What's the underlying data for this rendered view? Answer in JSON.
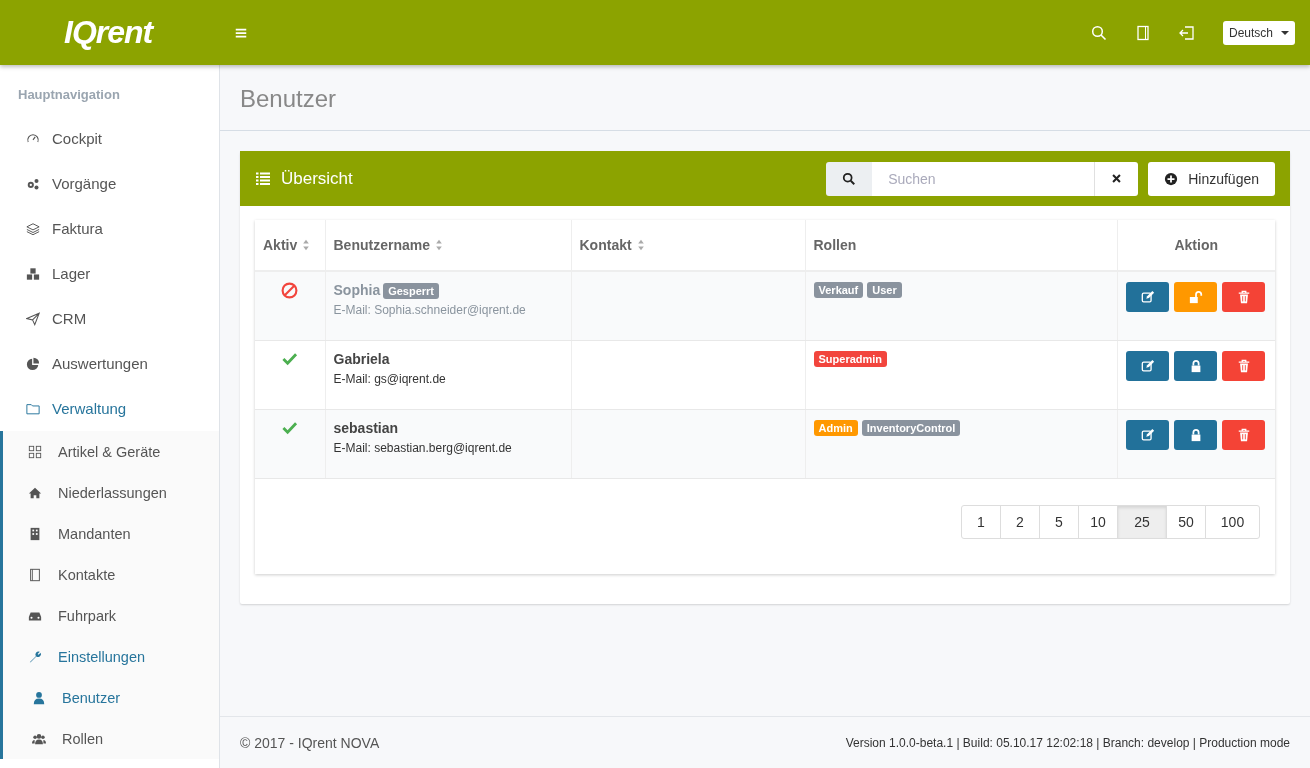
{
  "header": {
    "logo": "IQrent",
    "language": "Deutsch"
  },
  "sidebar": {
    "heading": "Hauptnavigation",
    "items": [
      {
        "label": "Cockpit",
        "selected": false
      },
      {
        "label": "Vorgänge",
        "selected": false
      },
      {
        "label": "Faktura",
        "selected": false
      },
      {
        "label": "Lager",
        "selected": false
      },
      {
        "label": "CRM",
        "selected": false
      },
      {
        "label": "Auswertungen",
        "selected": false
      },
      {
        "label": "Verwaltung",
        "expanded": true,
        "children": [
          {
            "label": "Artikel & Geräte",
            "selected": false
          },
          {
            "label": "Niederlassungen",
            "selected": false
          },
          {
            "label": "Mandanten",
            "selected": false
          },
          {
            "label": "Kontakte",
            "selected": false
          },
          {
            "label": "Fuhrpark",
            "selected": false
          },
          {
            "label": "Einstellungen",
            "expanded": true,
            "children": [
              {
                "label": "Benutzer",
                "selected": true
              },
              {
                "label": "Rollen",
                "selected": false
              }
            ]
          }
        ]
      }
    ]
  },
  "page": {
    "title": "Benutzer"
  },
  "panel": {
    "title": "Übersicht",
    "search": {
      "placeholder": "Suchen"
    },
    "add_button": "Hinzufügen"
  },
  "table": {
    "columns": [
      {
        "label": "Aktiv",
        "sortable": true
      },
      {
        "label": "Benutzername",
        "sortable": true
      },
      {
        "label": "Kontakt",
        "sortable": true
      },
      {
        "label": "Rollen",
        "sortable": false
      },
      {
        "label": "Aktion",
        "sortable": false
      }
    ],
    "rows": [
      {
        "active": false,
        "name": "Sophia",
        "badge": "Gesperrt",
        "email": "E-Mail: Sophia.schneider@iqrent.de",
        "locked": true,
        "roles": [
          {
            "label": "Verkauf",
            "color": "#8a939e"
          },
          {
            "label": "User",
            "color": "#8a939e"
          }
        ]
      },
      {
        "active": true,
        "name": "Gabriela",
        "email": "E-Mail: gs@iqrent.de",
        "locked": false,
        "roles": [
          {
            "label": "Superadmin",
            "color": "#f2453d"
          }
        ]
      },
      {
        "active": true,
        "name": "sebastian",
        "email": "E-Mail: sebastian.berg@iqrent.de",
        "locked": false,
        "roles": [
          {
            "label": "Admin",
            "color": "#ff9800"
          },
          {
            "label": "InventoryControl",
            "color": "#8a939e"
          }
        ]
      }
    ]
  },
  "pagination": [
    {
      "label": "1",
      "selected": false
    },
    {
      "label": "2",
      "selected": false
    },
    {
      "label": "5",
      "selected": false
    },
    {
      "label": "10",
      "selected": false
    },
    {
      "label": "25",
      "selected": true
    },
    {
      "label": "50",
      "selected": false
    },
    {
      "label": "100",
      "selected": false
    }
  ],
  "footer": {
    "copyright": "© 2017 - IQrent NOVA",
    "version": "Version 1.0.0-beta.1 | Build: 05.10.17 12:02:18 | Branch: develop | Production mode"
  }
}
